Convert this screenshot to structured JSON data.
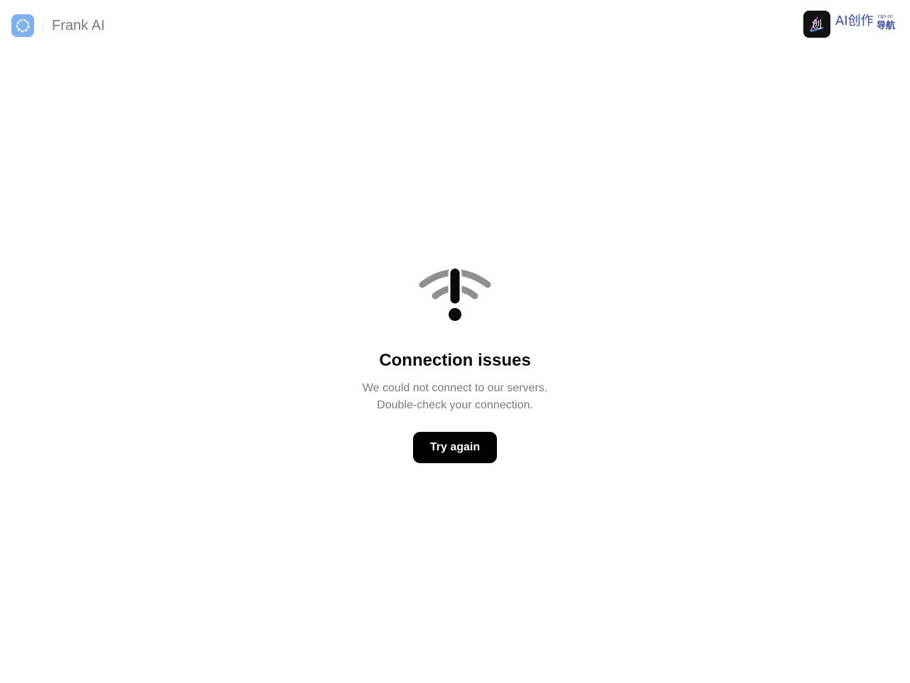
{
  "header": {
    "app_name": "Frank AI",
    "logo_icon": "chat-bubble-icon",
    "logo_color": "#7fb0ee"
  },
  "badge": {
    "icon": "chuang-character-logo-icon",
    "main_text": "AI创作",
    "sub_text": "导航",
    "domain_text": "cgn.cn",
    "text_color": "#3a4aa8"
  },
  "error": {
    "icon": "wifi-warning-icon",
    "title": "Connection issues",
    "line1": "We could not connect to our servers.",
    "line2": "Double-check your connection.",
    "button_label": "Try again"
  }
}
